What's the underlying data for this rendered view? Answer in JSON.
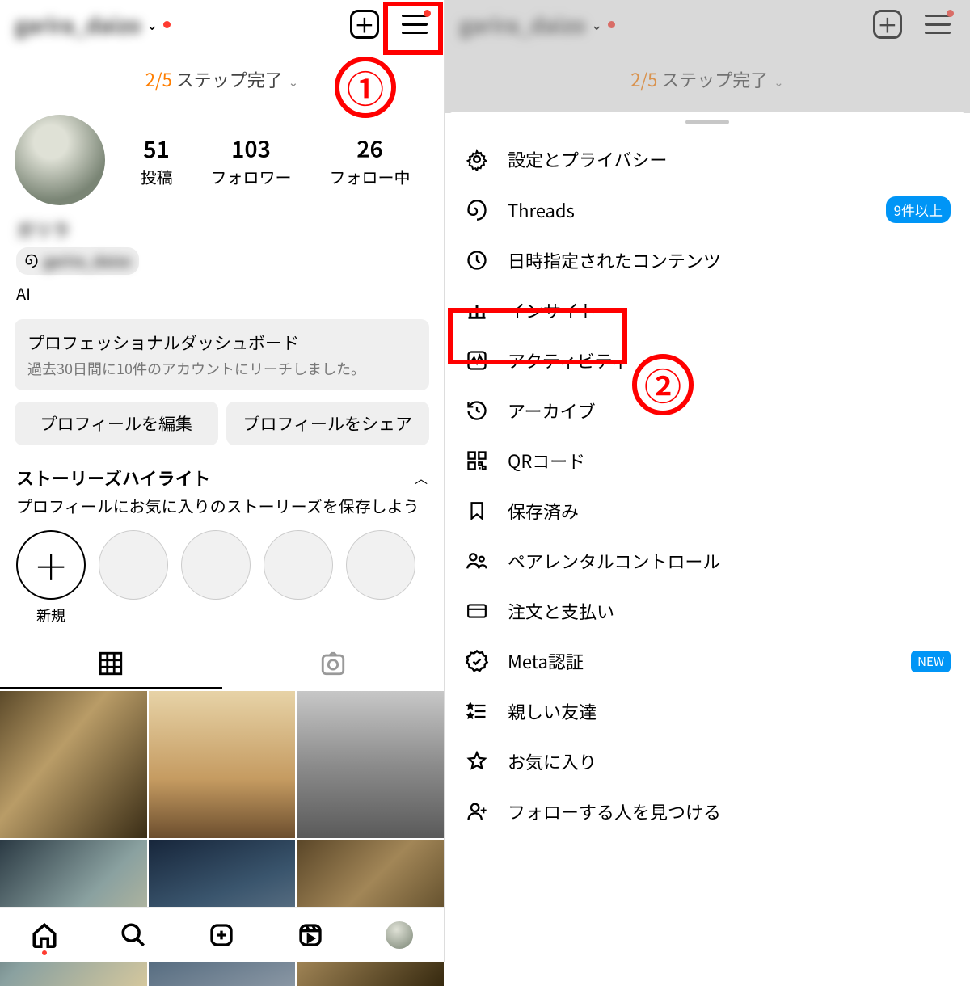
{
  "left": {
    "username": "garira_daizo",
    "step_count": "2/5",
    "step_text": " ステップ完了 ",
    "stats": {
      "posts_num": "51",
      "posts_label": "投稿",
      "followers_num": "103",
      "followers_label": "フォロワー",
      "following_num": "26",
      "following_label": "フォロー中"
    },
    "display_name": "ガリラ",
    "threads_handle": "garira_daizo",
    "bio": "AI",
    "dashboard": {
      "title": "プロフェッショナルダッシュボード",
      "sub": "過去30日間に10件のアカウントにリーチしました。"
    },
    "edit_btn": "プロフィールを編集",
    "share_btn": "プロフィールをシェア",
    "highlights": {
      "title": "ストーリーズハイライト",
      "sub": "プロフィールにお気に入りのストーリーズを保存しよう",
      "new_label": "新規"
    }
  },
  "right": {
    "username": "garira_daizo",
    "step_count": "2/5",
    "step_text": " ステップ完了 ",
    "threads_badge": "9件以上",
    "meta_badge": "NEW",
    "menu": {
      "settings": "設定とプライバシー",
      "threads": "Threads",
      "scheduled": "日時指定されたコンテンツ",
      "insights": "インサイト",
      "activity": "アクティビティ",
      "archive": "アーカイブ",
      "qr": "QRコード",
      "saved": "保存済み",
      "parental": "ペアレンタルコントロール",
      "orders": "注文と支払い",
      "meta": "Meta認証",
      "close_friends": "親しい友達",
      "favorites": "お気に入り",
      "discover": "フォローする人を見つける"
    }
  },
  "annotations": {
    "one": "①",
    "two": "②"
  }
}
